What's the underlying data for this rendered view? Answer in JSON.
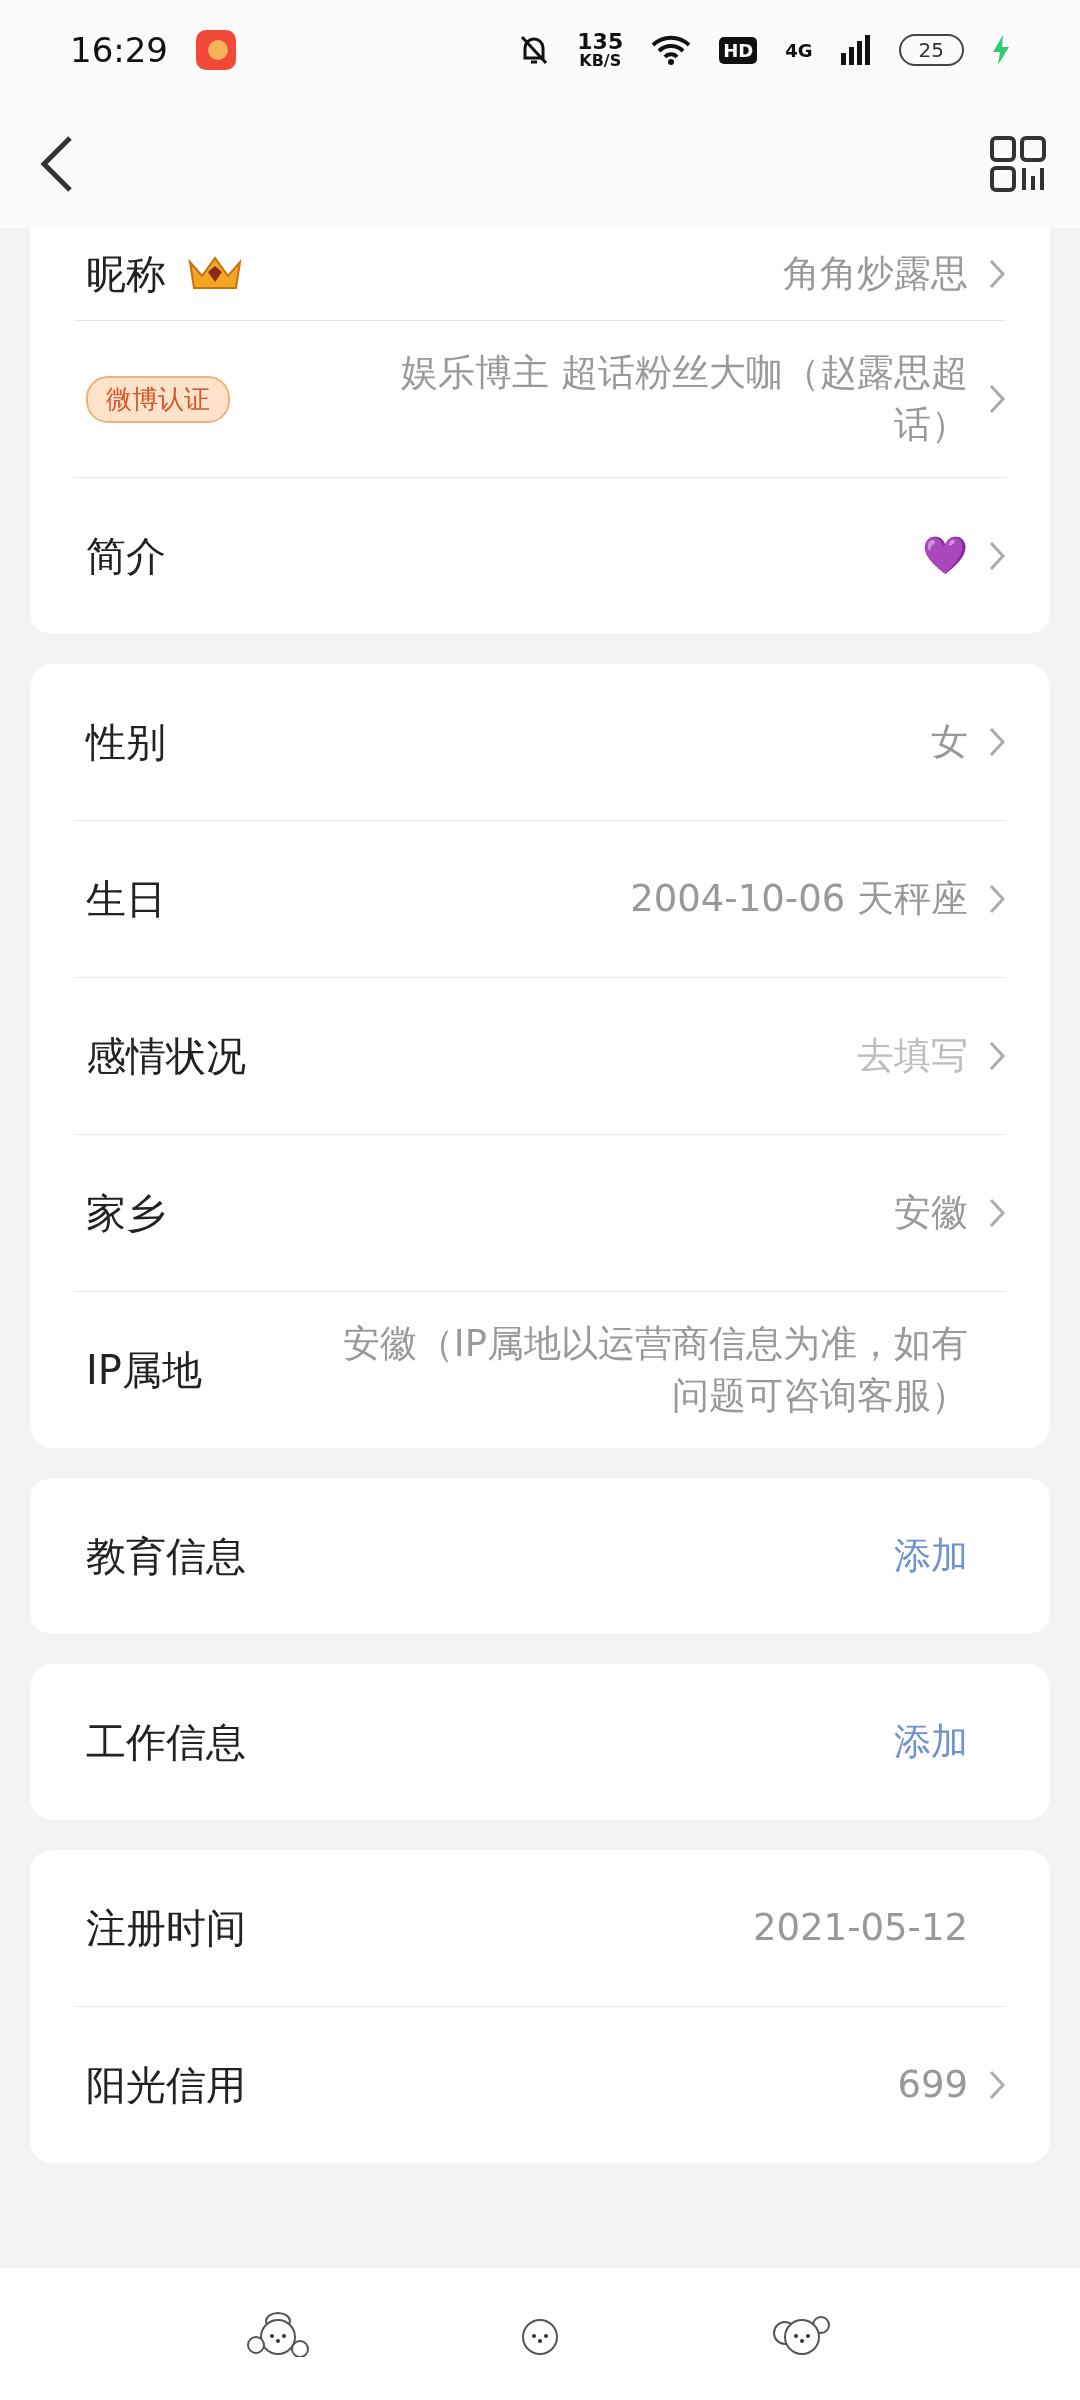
{
  "status_bar": {
    "time": "16:29",
    "speed": "135",
    "speed_unit": "KB/S",
    "hd": "HD",
    "network": "4G",
    "battery": "25"
  },
  "sections": [
    {
      "rows": [
        {
          "kind": "link",
          "label": "昵称",
          "vip": true,
          "value": "角角炒露思"
        },
        {
          "kind": "badge",
          "badge": "微博认证",
          "value": "娱乐博主 超话粉丝大咖（赵露思超话）"
        },
        {
          "kind": "link",
          "label": "简介",
          "value": "💜"
        }
      ]
    },
    {
      "rows": [
        {
          "kind": "link",
          "label": "性别",
          "value": "女"
        },
        {
          "kind": "link",
          "label": "生日",
          "value": "2004-10-06 天秤座"
        },
        {
          "kind": "link",
          "label": "感情状况",
          "value": "去填写",
          "placeholder": true
        },
        {
          "kind": "link",
          "label": "家乡",
          "value": "安徽"
        },
        {
          "kind": "plain",
          "label": "IP属地",
          "value": "安徽（IP属地以运营商信息为准，如有问题可咨询客服）"
        }
      ]
    },
    {
      "rows": [
        {
          "kind": "add",
          "label": "教育信息",
          "value": "添加"
        }
      ]
    },
    {
      "rows": [
        {
          "kind": "add",
          "label": "工作信息",
          "value": "添加"
        }
      ]
    },
    {
      "rows": [
        {
          "kind": "plain",
          "label": "注册时间",
          "value": "2021-05-12"
        },
        {
          "kind": "link",
          "label": "阳光信用",
          "value": "699"
        }
      ]
    }
  ]
}
